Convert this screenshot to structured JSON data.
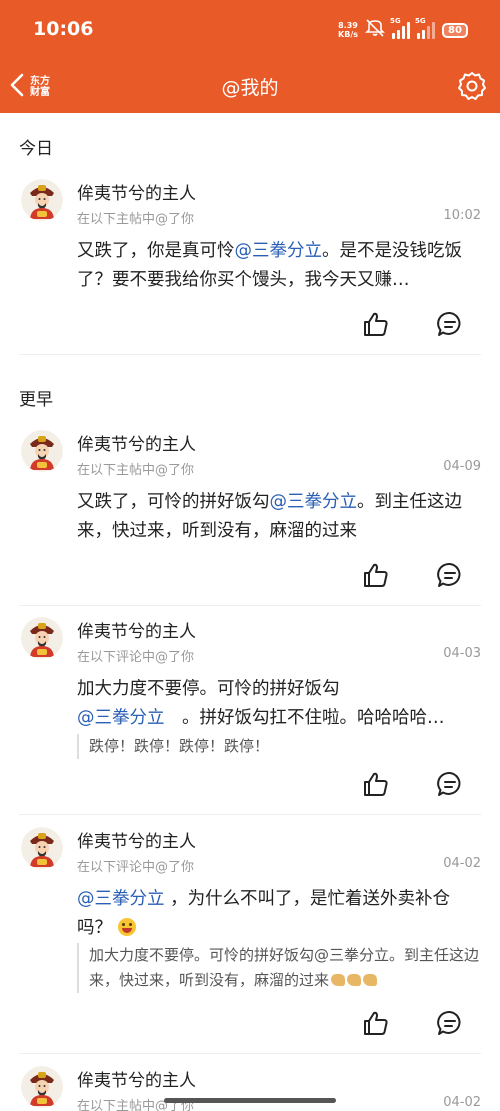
{
  "status_bar": {
    "time": "10:06",
    "net_speed": "8.39",
    "net_unit": "KB/s",
    "sim1_label": "5G",
    "sim2_label": "5G",
    "battery": "80"
  },
  "nav": {
    "brand_line1": "东方",
    "brand_line2": "财富",
    "title": "@我的"
  },
  "sections": {
    "today": "今日",
    "earlier": "更早"
  },
  "items": [
    {
      "user": "侔夷节兮的主人",
      "subtitle": "在以下主帖中@了你",
      "time": "10:02",
      "pre": "又跌了，你是真可怜",
      "mention": "@三拳分立",
      "post": "。是不是没钱吃饭了？要不要我给你买个馒头，我今天又赚…"
    },
    {
      "user": "侔夷节兮的主人",
      "subtitle": "在以下主帖中@了你",
      "time": "04-09",
      "pre": "又跌了，可怜的拼好饭勾",
      "mention": "@三拳分立",
      "post": "。到主任这边来，快过来，听到没有，麻溜的过来"
    },
    {
      "user": "侔夷节兮的主人",
      "subtitle": "在以下评论中@了你",
      "time": "04-03",
      "pre": "加大力度不要停。可怜的拼好饭勾",
      "mention": "@三拳分立",
      "post": "　。拼好饭勾扛不住啦。哈哈哈哈…",
      "quote": "跌停！跌停！跌停！跌停！"
    },
    {
      "user": "侔夷节兮的主人",
      "subtitle": "在以下评论中@了你",
      "time": "04-02",
      "pre": "",
      "mention": "@三拳分立",
      "post": " ，为什么不叫了，是忙着送外卖补仓吗？",
      "quote": "加大力度不要停。可怜的拼好饭勾@三拳分立。到主任这边来，快过来，听到没有，麻溜的过来"
    },
    {
      "user": "侔夷节兮的主人",
      "subtitle": "在以下主帖中@了你",
      "time": "04-02"
    }
  ],
  "icons": {
    "back": "chevron-left-icon",
    "settings": "gear-icon",
    "like": "thumbs-up-icon",
    "comment": "comment-icon",
    "avatar": "caishen-avatar",
    "emoji": "grinning-emoji",
    "clap": "clapping-hands-emoji"
  },
  "colors": {
    "header_bg": "#e85a28",
    "mention": "#2a5fb5",
    "muted": "#999999"
  }
}
